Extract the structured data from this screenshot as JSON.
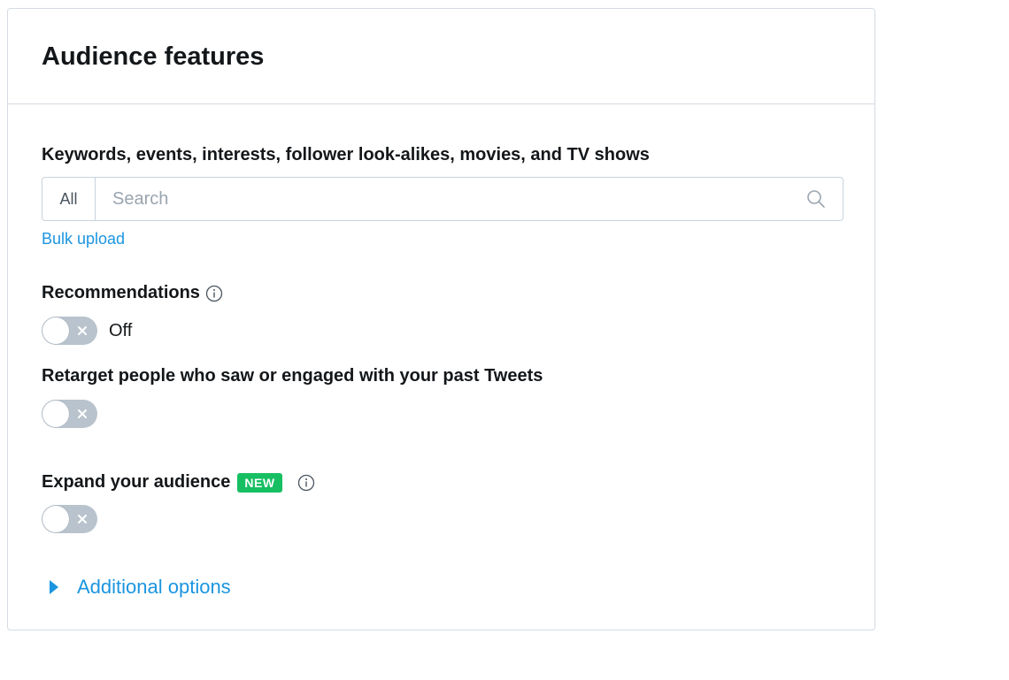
{
  "card": {
    "title": "Audience features"
  },
  "targeting": {
    "label": "Keywords, events, interests, follower look-alikes, movies, and TV shows",
    "scope": "All",
    "search_placeholder": "Search",
    "search_value": "",
    "bulk_upload_label": "Bulk upload"
  },
  "recommendations": {
    "label": "Recommendations",
    "enabled": false,
    "status_label": "Off"
  },
  "retarget": {
    "label": "Retarget people who saw or engaged with your past Tweets",
    "enabled": false
  },
  "expand": {
    "label": "Expand your audience",
    "badge": "NEW",
    "enabled": false
  },
  "additional": {
    "label": "Additional options"
  },
  "colors": {
    "accent": "#1b95e0",
    "badge": "#17bf63",
    "toggle_off": "#b8c3cd",
    "border": "#d4dbe2"
  },
  "icons": {
    "search": "search-icon",
    "info": "info-icon",
    "toggle_off": "close-icon",
    "expand": "caret-right-icon"
  }
}
